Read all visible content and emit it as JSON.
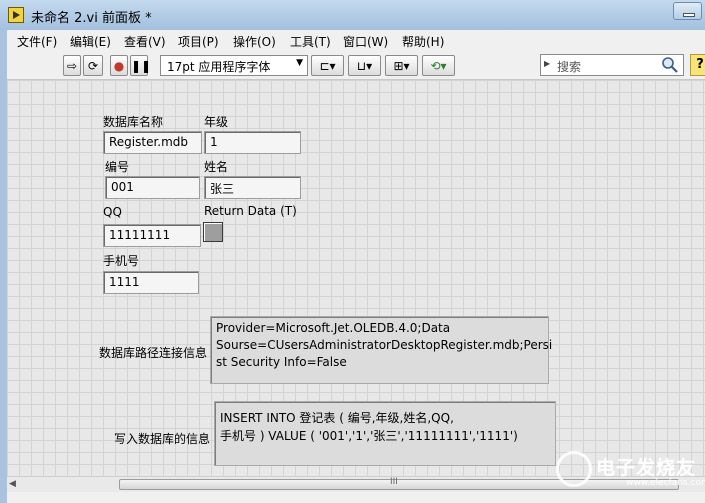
{
  "window": {
    "title": "未命名 2.vi 前面板 *"
  },
  "menu": [
    "文件(F)",
    "编辑(E)",
    "查看(V)",
    "项目(P)",
    "操作(O)",
    "工具(T)",
    "窗口(W)",
    "帮助(H)"
  ],
  "toolbar": {
    "font": "17pt 应用程序字体",
    "search_placeholder": "搜索",
    "help": "?"
  },
  "controls": {
    "db_name_label": "数据库名称",
    "db_name_value": "Register.mdb",
    "grade_label": "年级",
    "grade_value": "1",
    "id_label": "编号",
    "id_value": "001",
    "name_label": "姓名",
    "name_value": "张三",
    "qq_label": "QQ",
    "qq_value": "11111111",
    "return_label": "Return Data (T)",
    "phone_label": "手机号",
    "phone_value": "1111",
    "conn_label": "数据库路径连接信息",
    "conn_lines": [
      "Provider=Microsoft.Jet.OLEDB.4.0;Data",
      "Sourse=CUsersAdministratorDesktopRegister.mdb;Persi",
      "st Security Info=False"
    ],
    "write_label": "写入数据库的信息",
    "write_lines": [
      "INSERT INTO 登记表 ( 编号,年级,姓名,QQ,",
      "手机号 ) VALUE ( '001','1','张三','11111111','1111')"
    ]
  },
  "watermark": {
    "text": "电子发烧友",
    "url": "www.elecfans.com"
  },
  "scroll_grip": "III"
}
